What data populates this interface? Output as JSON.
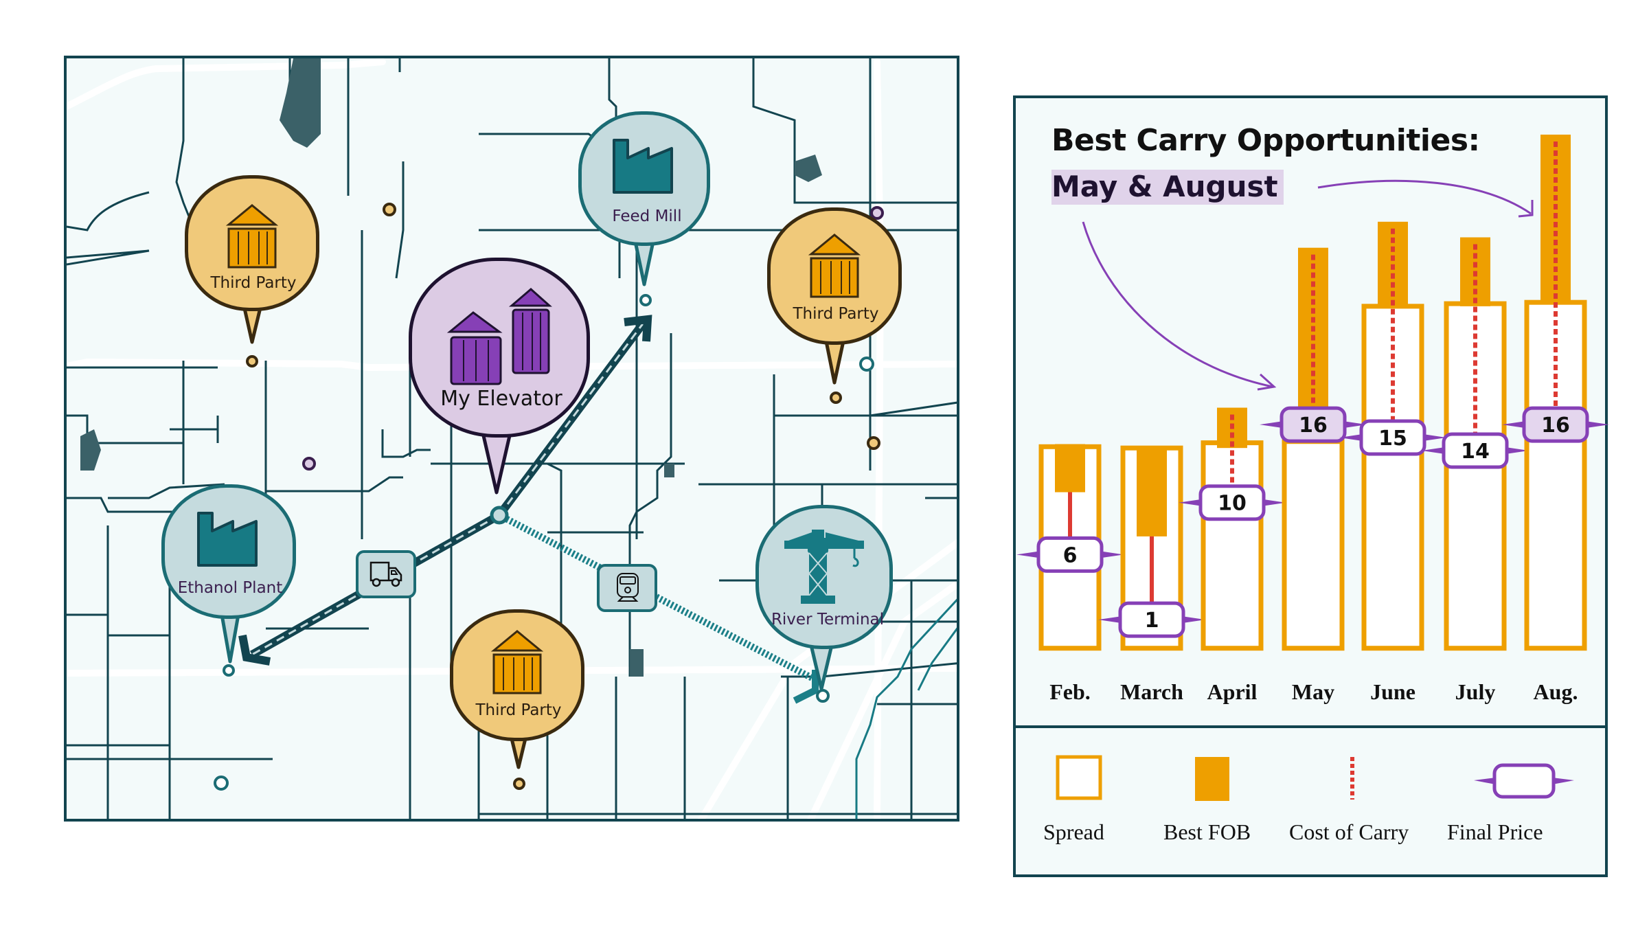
{
  "map": {
    "markers": [
      {
        "id": "third-party-nw",
        "label": "Third Party",
        "type": "third-party",
        "icon": "silo-icon"
      },
      {
        "id": "feed-mill",
        "label": "Feed Mill",
        "type": "destination",
        "icon": "factory-icon"
      },
      {
        "id": "third-party-ne",
        "label": "Third Party",
        "type": "third-party",
        "icon": "silo-icon"
      },
      {
        "id": "my-elevator",
        "label": "My Elevator",
        "type": "origin",
        "icon": "twin-silo-icon"
      },
      {
        "id": "ethanol-plant",
        "label": "Ethanol Plant",
        "type": "destination",
        "icon": "factory-icon"
      },
      {
        "id": "river-terminal",
        "label": "River Terminal",
        "type": "destination",
        "icon": "crane-icon"
      },
      {
        "id": "third-party-s",
        "label": "Third Party",
        "type": "third-party",
        "icon": "silo-icon"
      }
    ],
    "routes": [
      {
        "from": "My Elevator",
        "to": "Feed Mill",
        "mode": "truck"
      },
      {
        "from": "My Elevator",
        "to": "Ethanol Plant",
        "mode": "truck",
        "icon": "truck-icon"
      },
      {
        "from": "My Elevator",
        "to": "River Terminal",
        "mode": "rail",
        "icon": "train-icon"
      }
    ],
    "colors": {
      "third_party": "#f0c97a",
      "third_party_icon": "#ee9f00",
      "destination": "#c5dbde",
      "destination_icon": "#177a84",
      "origin": "#dccbe4",
      "origin_icon": "#8640b6",
      "road": "#12444f",
      "water": "#3b6168"
    }
  },
  "chart_data": {
    "type": "bar",
    "title": "Best Carry Opportunities:",
    "subtitle": "May & August",
    "highlight": [
      "May",
      "Aug."
    ],
    "categories": [
      "Feb.",
      "March",
      "April",
      "May",
      "June",
      "July",
      "Aug."
    ],
    "series": [
      {
        "name": "Spread",
        "kind": "outline-bar",
        "values": [
          [
            -1.2,
            14.3
          ],
          [
            -1.2,
            14.2
          ],
          [
            -1.2,
            14.6
          ],
          [
            -1.2,
            14.7
          ],
          [
            -1.2,
            25.1
          ],
          [
            -1.2,
            25.3
          ],
          [
            -1.2,
            25.4
          ]
        ]
      },
      {
        "name": "Best FOB",
        "kind": "floating-bar",
        "values": [
          [
            10.8,
            14.5
          ],
          [
            7.4,
            14.1
          ],
          [
            14.2,
            17.3
          ],
          [
            17.2,
            29.6
          ],
          [
            25.1,
            31.6
          ],
          [
            25.1,
            30.4
          ],
          [
            25.3,
            38.3
          ]
        ]
      },
      {
        "name": "Cost of Carry",
        "kind": "line",
        "style": [
          "solid",
          "solid",
          "dashed",
          "dashed",
          "dashed",
          "dashed",
          "dashed"
        ]
      },
      {
        "name": "Final Price",
        "kind": "label",
        "values": [
          6,
          1,
          10,
          16,
          15,
          14,
          16
        ]
      }
    ],
    "legend": [
      {
        "label": "Spread",
        "swatch": "outline"
      },
      {
        "label": "Best FOB",
        "swatch": "fill"
      },
      {
        "label": "Cost of Carry",
        "swatch": "dashed-line"
      },
      {
        "label": "Final Price",
        "swatch": "tag"
      }
    ],
    "legend_position": "bottom",
    "xlabel": "",
    "ylabel": "",
    "grid": false,
    "colors": {
      "spread": "#ee9f00",
      "fob": "#ee9f00",
      "carry": "#dd3a32",
      "final_price_border": "#8640b6",
      "final_price_highlight": "#e4d6ee"
    }
  }
}
